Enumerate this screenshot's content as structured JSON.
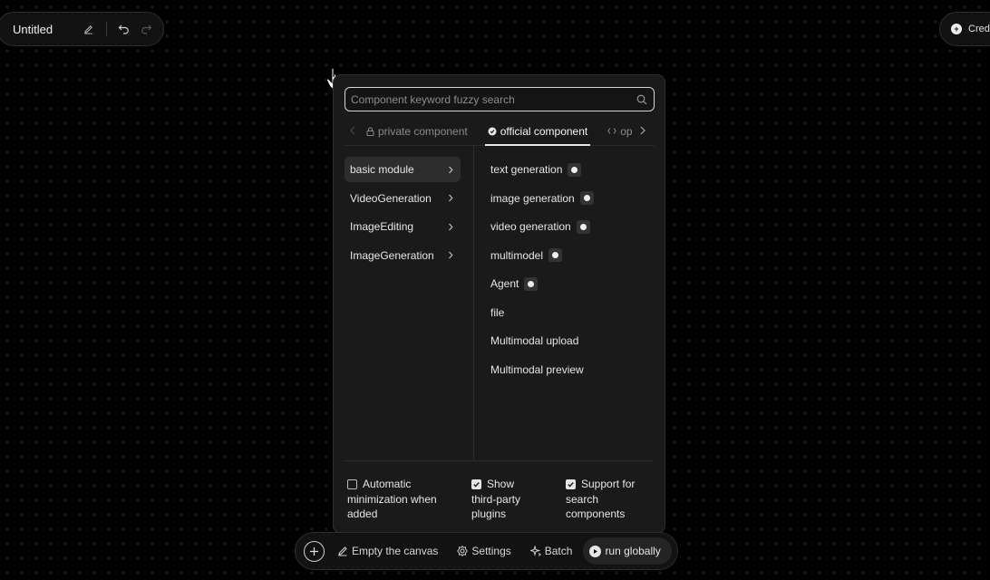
{
  "header": {
    "title": "Untitled",
    "edit_icon": "pencil-icon",
    "undo_icon": "undo-icon",
    "redo_icon": "redo-icon",
    "credit_label": "Credi"
  },
  "search": {
    "placeholder": "Component keyword fuzzy search",
    "value": ""
  },
  "tabs": [
    {
      "label": "private component",
      "icon": "lock-icon",
      "active": false
    },
    {
      "label": "official component",
      "icon": "official-icon",
      "active": true
    },
    {
      "label": "op",
      "icon": "code-icon",
      "active": false
    }
  ],
  "categories": [
    {
      "label": "basic module",
      "active": true
    },
    {
      "label": "VideoGeneration",
      "active": false
    },
    {
      "label": "ImageEditing",
      "active": false
    },
    {
      "label": "ImageGeneration",
      "active": false
    }
  ],
  "components": [
    {
      "label": "text generation",
      "badge": true
    },
    {
      "label": "image generation",
      "badge": true
    },
    {
      "label": "video generation",
      "badge": true
    },
    {
      "label": "multimodel",
      "badge": true
    },
    {
      "label": "Agent",
      "badge": true
    },
    {
      "label": "file",
      "badge": false
    },
    {
      "label": "Multimodal upload",
      "badge": false
    },
    {
      "label": "Multimodal preview",
      "badge": false
    }
  ],
  "options": {
    "auto_minimize": {
      "lines": [
        "Automatic",
        "minimization when",
        "added"
      ],
      "checked": false
    },
    "third_party": {
      "lines": [
        "Show",
        "third-party",
        "plugins"
      ],
      "checked": true
    },
    "search_components": {
      "lines": [
        "Support for",
        "search",
        "components"
      ],
      "checked": true
    }
  },
  "bottombar": {
    "add_icon": "plus-icon",
    "empty_canvas": "Empty the canvas",
    "settings": "Settings",
    "batch": "Batch",
    "run_globally": "run globally"
  },
  "colors": {
    "background": "#000000",
    "panel": "#1a1a1a",
    "text": "#e6e6e6",
    "muted": "#8a8a8a"
  }
}
